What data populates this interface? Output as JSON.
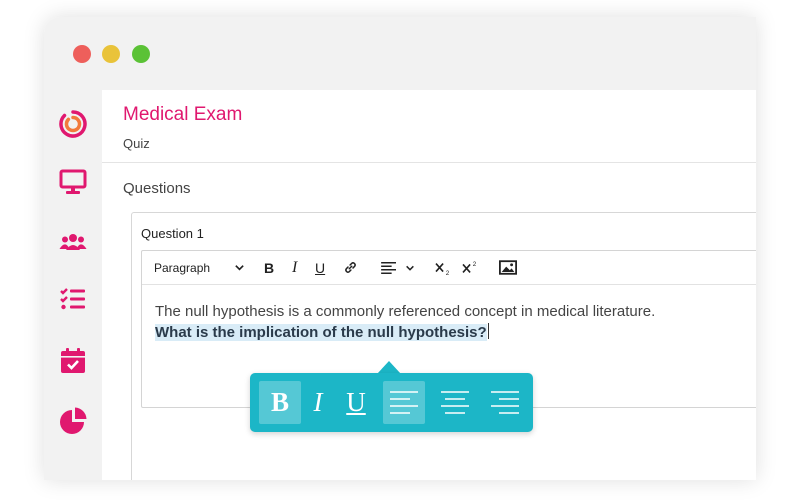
{
  "window": {
    "controls": [
      "close",
      "minimize",
      "maximize"
    ]
  },
  "sidebar": {
    "items": [
      {
        "name": "logo-icon"
      },
      {
        "name": "monitor-icon"
      },
      {
        "name": "users-icon"
      },
      {
        "name": "checklist-icon"
      },
      {
        "name": "calendar-check-icon"
      },
      {
        "name": "pie-chart-icon"
      }
    ]
  },
  "header": {
    "title": "Medical Exam",
    "subtitle": "Quiz"
  },
  "section": {
    "heading": "Questions"
  },
  "question": {
    "label": "Question 1",
    "toolbar": {
      "block_format": "Paragraph",
      "bold": "B",
      "italic": "I",
      "underline": "U",
      "icons": [
        "chevron-down-icon",
        "link-icon",
        "align-left-icon",
        "subscript-icon",
        "superscript-icon",
        "image-icon"
      ]
    },
    "text_line1": "The null hypothesis is a commonly referenced concept in medical literature.",
    "text_line2": "What is the implication of the null hypothesis?"
  },
  "format_popup": {
    "bold": "B",
    "italic": "I",
    "underline": "U",
    "active": [
      "bold",
      "align-left"
    ],
    "icons": [
      "align-left-icon",
      "align-center-icon",
      "align-right-icon"
    ]
  },
  "colors": {
    "brand": "#e0186f",
    "popup": "#1cb6c7",
    "highlight": "#d9ecf7"
  }
}
